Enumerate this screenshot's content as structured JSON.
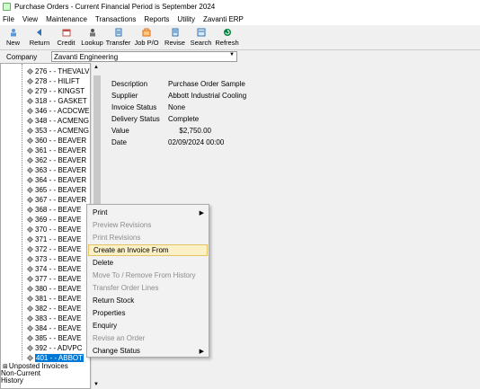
{
  "window": {
    "title": "Purchase Orders - Current Financial Period is September 2024"
  },
  "menu": [
    "File",
    "View",
    "Maintenance",
    "Transactions",
    "Reports",
    "Utility",
    "Zavanti ERP"
  ],
  "toolbar": [
    {
      "label": "New",
      "icon": "new-icon",
      "color": "#5b9bd5"
    },
    {
      "label": "Return",
      "icon": "back-arrow-icon",
      "color": "#2e74b5"
    },
    {
      "label": "Credit",
      "icon": "credit-icon",
      "color": "#c0504d"
    },
    {
      "label": "Lookup",
      "icon": "lookup-icon",
      "color": "#555555"
    },
    {
      "label": "Transfer",
      "icon": "transfer-icon",
      "color": "#2e74b5"
    },
    {
      "label": "Job P/O",
      "icon": "job-po-icon",
      "color": "#e36c09"
    },
    {
      "label": "Revise",
      "icon": "revise-icon",
      "color": "#2e74b5"
    },
    {
      "label": "Search",
      "icon": "search-icon",
      "color": "#2e74b5"
    },
    {
      "label": "Refresh",
      "icon": "refresh-icon",
      "color": "#00843d"
    }
  ],
  "company": {
    "label": "Company",
    "value": "Zavanti Engineering"
  },
  "tree": {
    "rows": [
      "276 - - THEVALVE",
      "278 - - HILIFT",
      "279 - - KINGST",
      "318 - - GASKET",
      "346 - - ACDCWEL",
      "348 - - ACMENG",
      "353 - - ACMENG",
      "360 - - BEAVER",
      "361 - - BEAVER",
      "362 - - BEAVER",
      "363 - - BEAVER",
      "364 - - BEAVER",
      "365 - - BEAVER",
      "367 - - BEAVER",
      "368 - - BEAVE",
      "369 - - BEAVE",
      "370 - - BEAVE",
      "371 - - BEAVE",
      "372 - - BEAVE",
      "373 - - BEAVE",
      "374 - - BEAVE",
      "377 - - BEAVE",
      "380 - - BEAVE",
      "381 - - BEAVE",
      "382 - - BEAVE",
      "383 - - BEAVE",
      "384 - - BEAVE",
      "385 - - BEAVE",
      "392 - - ADVPC",
      "401 - - ABBOT"
    ],
    "selected": "401 - - ABBOT",
    "folders": [
      "Unposted Invoices",
      "Non-Current",
      "History"
    ]
  },
  "details": {
    "fields": [
      {
        "label": "Description",
        "value": "Purchase Order Sample"
      },
      {
        "label": "Supplier",
        "value": "Abbott Industrial Cooling"
      },
      {
        "label": "Invoice Status",
        "value": "None"
      },
      {
        "label": "Delivery Status",
        "value": "Complete"
      },
      {
        "label": "Value",
        "value": "$2,750.00"
      },
      {
        "label": "Date",
        "value": "02/09/2024 00:00"
      }
    ]
  },
  "context_menu": {
    "items": [
      {
        "label": "Print",
        "enabled": true,
        "submenu": true
      },
      {
        "label": "Preview Revisions",
        "enabled": false
      },
      {
        "label": "Print Revisions",
        "enabled": false
      },
      {
        "label": "Create an Invoice From",
        "enabled": true,
        "highlighted": true
      },
      {
        "label": "Delete",
        "enabled": true
      },
      {
        "label": "Move To / Remove From History",
        "enabled": false
      },
      {
        "label": "Transfer Order Lines",
        "enabled": false
      },
      {
        "label": "Return Stock",
        "enabled": true
      },
      {
        "label": "Properties",
        "enabled": true
      },
      {
        "label": "Enquiry",
        "enabled": true
      },
      {
        "label": "Revise an Order",
        "enabled": false
      },
      {
        "label": "Change Status",
        "enabled": true,
        "submenu": true
      }
    ]
  },
  "colors": {
    "selection": "#0078d7",
    "hover": "#fbf0c6"
  }
}
